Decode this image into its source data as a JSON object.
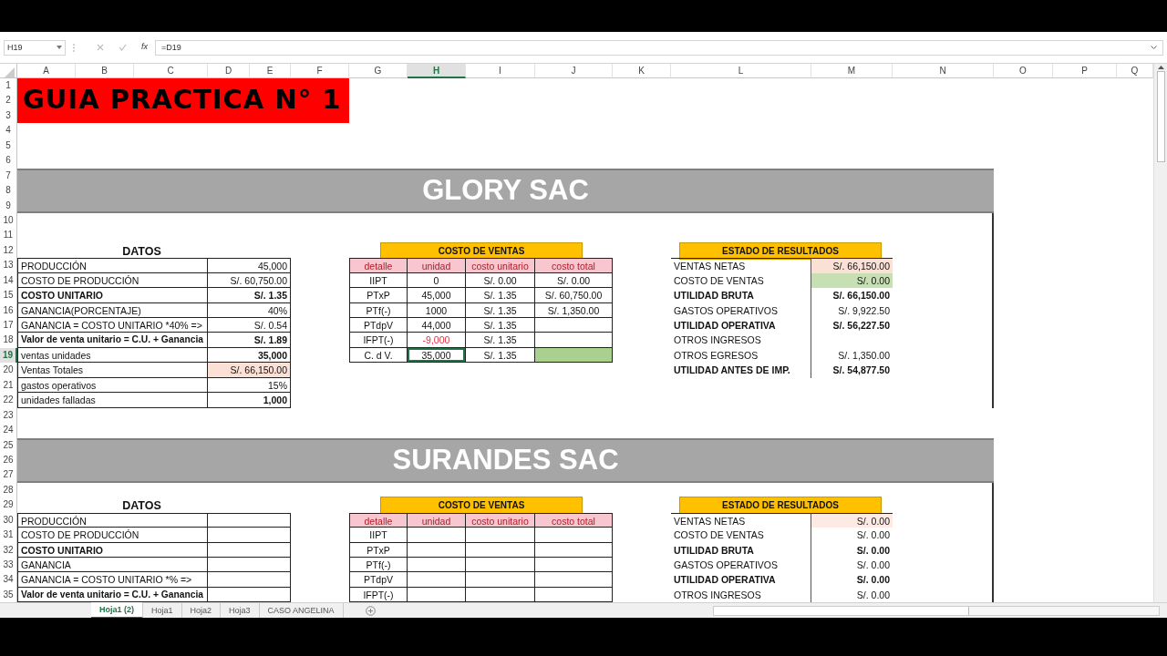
{
  "formula_bar": {
    "name_box": "H19",
    "function_label": "fx",
    "formula": "=D19"
  },
  "column_headers": [
    {
      "label": "A",
      "selected": false
    },
    {
      "label": "B",
      "selected": false
    },
    {
      "label": "C",
      "selected": false
    },
    {
      "label": "D",
      "selected": false
    },
    {
      "label": "E",
      "selected": false
    },
    {
      "label": "F",
      "selected": false
    },
    {
      "label": "G",
      "selected": false
    },
    {
      "label": "H",
      "selected": true
    },
    {
      "label": "I",
      "selected": false
    },
    {
      "label": "J",
      "selected": false
    },
    {
      "label": "K",
      "selected": false
    },
    {
      "label": "L",
      "selected": false
    },
    {
      "label": "M",
      "selected": false
    },
    {
      "label": "N",
      "selected": false
    },
    {
      "label": "O",
      "selected": false
    },
    {
      "label": "P",
      "selected": false
    },
    {
      "label": "Q",
      "selected": false
    }
  ],
  "row_numbers": [
    {
      "label": "1",
      "selected": false
    },
    {
      "label": "2",
      "selected": false
    },
    {
      "label": "3",
      "selected": false
    },
    {
      "label": "4",
      "selected": false
    },
    {
      "label": "5",
      "selected": false
    },
    {
      "label": "6",
      "selected": false
    },
    {
      "label": "7",
      "selected": false
    },
    {
      "label": "8",
      "selected": false
    },
    {
      "label": "9",
      "selected": false
    },
    {
      "label": "10",
      "selected": false
    },
    {
      "label": "11",
      "selected": false
    },
    {
      "label": "12",
      "selected": false
    },
    {
      "label": "13",
      "selected": false
    },
    {
      "label": "14",
      "selected": false
    },
    {
      "label": "15",
      "selected": false
    },
    {
      "label": "16",
      "selected": false
    },
    {
      "label": "17",
      "selected": false
    },
    {
      "label": "18",
      "selected": false
    },
    {
      "label": "19",
      "selected": true
    },
    {
      "label": "20",
      "selected": false
    },
    {
      "label": "21",
      "selected": false
    },
    {
      "label": "22",
      "selected": false
    },
    {
      "label": "23",
      "selected": false
    },
    {
      "label": "24",
      "selected": false
    },
    {
      "label": "25",
      "selected": false
    },
    {
      "label": "26",
      "selected": false
    },
    {
      "label": "27",
      "selected": false
    },
    {
      "label": "28",
      "selected": false
    },
    {
      "label": "29",
      "selected": false
    },
    {
      "label": "30",
      "selected": false
    },
    {
      "label": "31",
      "selected": false
    },
    {
      "label": "32",
      "selected": false
    },
    {
      "label": "33",
      "selected": false
    },
    {
      "label": "34",
      "selected": false
    },
    {
      "label": "35",
      "selected": false
    }
  ],
  "title_banner": "GUIA PRACTICA N° 1",
  "companies": [
    {
      "name": "GLORY SAC",
      "datos": {
        "title": "DATOS",
        "rows": [
          {
            "label": "PRODUCCIÓN",
            "value": "45,000",
            "bold": false,
            "value_bold": false
          },
          {
            "label": "COSTO DE PRODUCCIÓN",
            "value": "S/. 60,750.00",
            "bold": false,
            "value_bold": false
          },
          {
            "label": "COSTO UNITARIO",
            "value": "S/. 1.35",
            "bold": true,
            "value_bold": true
          },
          {
            "label": "GANANCIA(PORCENTAJE)",
            "value": "40%",
            "bold": false,
            "value_bold": false
          },
          {
            "label": "GANANCIA = COSTO UNITARIO *40% =>",
            "value": "S/. 0.54",
            "bold": false,
            "value_bold": false
          },
          {
            "label": "Valor de venta unitario = C.U. + Ganancia",
            "value": "S/. 1.89",
            "bold": true,
            "value_bold": true
          },
          {
            "label": "ventas unidades",
            "value": "35,000",
            "bold": false,
            "value_bold": true
          },
          {
            "label": "Ventas Totales",
            "value": "S/. 66,150.00",
            "bold": false,
            "value_bold": false,
            "color": "#fbe0d6"
          },
          {
            "label": "gastos operativos",
            "value": "15%",
            "bold": false,
            "value_bold": false
          },
          {
            "label": "unidades falladas",
            "value": "1,000",
            "bold": false,
            "value_bold": true
          }
        ]
      },
      "costo_de_ventas": {
        "title": "COSTO DE VENTAS",
        "columns": [
          "detalle",
          "unidad",
          "costo unitario",
          "costo total"
        ],
        "rows": [
          {
            "detalle": "IIPT",
            "unidad": "0",
            "costo_unitario": "S/. 0.00",
            "costo_total": "S/. 0.00",
            "unidad_negative": false
          },
          {
            "detalle": "PTxP",
            "unidad": "45,000",
            "costo_unitario": "S/. 1.35",
            "costo_total": "S/. 60,750.00",
            "unidad_negative": false
          },
          {
            "detalle": "PTf(-)",
            "unidad": "1000",
            "costo_unitario": "S/. 1.35",
            "costo_total": "S/. 1,350.00",
            "unidad_negative": false
          },
          {
            "detalle": "PTdpV",
            "unidad": "44,000",
            "costo_unitario": "S/. 1.35",
            "unidad_negative": false
          },
          {
            "detalle": "IFPT(-)",
            "unidad": "-9,000",
            "costo_unitario": "S/. 1.35",
            "unidad_negative": true
          },
          {
            "detalle": "C. d V.",
            "unidad": "35,000",
            "costo_unitario": "S/. 1.35",
            "unidad_negative": false,
            "color": "#a9d08e"
          }
        ]
      },
      "estado_de_resultados": {
        "title": "ESTADO DE RESULTADOS",
        "rows": [
          {
            "label": "VENTAS NETAS",
            "value": "S/. 66,150.00",
            "bold": false,
            "color": "#fbe0d6"
          },
          {
            "label": "COSTO DE VENTAS",
            "value": "S/. 0.00",
            "bold": false,
            "color": "#c6e0b4"
          },
          {
            "label": "UTILIDAD BRUTA",
            "value": "S/. 66,150.00",
            "bold": true
          },
          {
            "label": "GASTOS OPERATIVOS",
            "value": "S/. 9,922.50",
            "bold": false
          },
          {
            "label": "UTILIDAD OPERATIVA",
            "value": "S/. 56,227.50",
            "bold": true
          },
          {
            "label": "OTROS INGRESOS",
            "bold": false
          },
          {
            "label": "OTROS EGRESOS",
            "value": "S/. 1,350.00",
            "bold": false
          },
          {
            "label": "UTILIDAD ANTES DE IMP.",
            "value": "S/. 54,877.50",
            "bold": true
          }
        ]
      }
    },
    {
      "name": "SURANDES SAC",
      "datos": {
        "title": "DATOS",
        "rows": [
          {
            "label": "PRODUCCIÓN",
            "bold": false
          },
          {
            "label": "COSTO DE PRODUCCIÓN",
            "bold": false
          },
          {
            "label": "COSTO UNITARIO",
            "bold": true
          },
          {
            "label": "GANANCIA",
            "bold": false
          },
          {
            "label": "GANANCIA = COSTO UNITARIO *% =>",
            "bold": false
          },
          {
            "label": "Valor de venta unitario = C.U. + Ganancia",
            "bold": true
          }
        ]
      },
      "costo_de_ventas": {
        "title": "COSTO DE VENTAS",
        "columns": [
          "detalle",
          "unidad",
          "costo unitario",
          "costo total"
        ],
        "rows": [
          {
            "detalle": "IIPT",
            "unidad_negative": false
          },
          {
            "detalle": "PTxP",
            "unidad_negative": false
          },
          {
            "detalle": "PTf(-)",
            "unidad_negative": false
          },
          {
            "detalle": "PTdpV",
            "unidad_negative": false
          },
          {
            "detalle": "IFPT(-)",
            "unidad_negative": false
          }
        ]
      },
      "estado_de_resultados": {
        "title": "ESTADO DE RESULTADOS",
        "rows": [
          {
            "label": "VENTAS NETAS",
            "value": "S/. 0.00",
            "bold": false,
            "color": "#fdeae5"
          },
          {
            "label": "COSTO DE VENTAS",
            "value": "S/. 0.00",
            "bold": false
          },
          {
            "label": "UTILIDAD BRUTA",
            "value": "S/. 0.00",
            "bold": true
          },
          {
            "label": "GASTOS OPERATIVOS",
            "value": "S/. 0.00",
            "bold": false
          },
          {
            "label": "UTILIDAD OPERATIVA",
            "value": "S/. 0.00",
            "bold": true
          },
          {
            "label": "OTROS INGRESOS",
            "value": "S/. 0.00",
            "bold": false
          }
        ]
      }
    }
  ],
  "sheet_tabs": [
    {
      "label": "Hoja1 (2)",
      "selected": true
    },
    {
      "label": "Hoja1",
      "selected": false
    },
    {
      "label": "Hoja2",
      "selected": false
    },
    {
      "label": "Hoja3",
      "selected": false
    },
    {
      "label": "CASO ANGELINA",
      "selected": false
    }
  ]
}
